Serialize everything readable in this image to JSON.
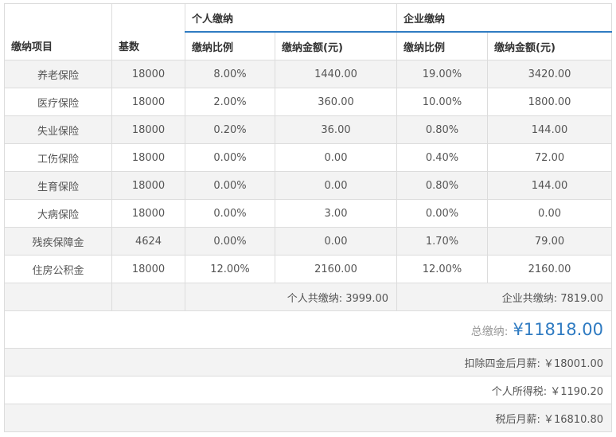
{
  "headers": {
    "item": "缴纳项目",
    "base": "基数",
    "personal_group": "个人缴纳",
    "company_group": "企业缴纳",
    "ratio": "缴纳比例",
    "amount": "缴纳金额(元)"
  },
  "rows": [
    {
      "name": "养老保险",
      "base": "18000",
      "p_ratio": "8.00%",
      "p_amount": "1440.00",
      "c_ratio": "19.00%",
      "c_amount": "3420.00"
    },
    {
      "name": "医疗保险",
      "base": "18000",
      "p_ratio": "2.00%",
      "p_amount": "360.00",
      "c_ratio": "10.00%",
      "c_amount": "1800.00"
    },
    {
      "name": "失业保险",
      "base": "18000",
      "p_ratio": "0.20%",
      "p_amount": "36.00",
      "c_ratio": "0.80%",
      "c_amount": "144.00"
    },
    {
      "name": "工伤保险",
      "base": "18000",
      "p_ratio": "0.00%",
      "p_amount": "0.00",
      "c_ratio": "0.40%",
      "c_amount": "72.00"
    },
    {
      "name": "生育保险",
      "base": "18000",
      "p_ratio": "0.00%",
      "p_amount": "0.00",
      "c_ratio": "0.80%",
      "c_amount": "144.00"
    },
    {
      "name": "大病保险",
      "base": "18000",
      "p_ratio": "0.00%",
      "p_amount": "3.00",
      "c_ratio": "0.00%",
      "c_amount": "0.00"
    },
    {
      "name": "残疾保障金",
      "base": "4624",
      "p_ratio": "0.00%",
      "p_amount": "0.00",
      "c_ratio": "1.70%",
      "c_amount": "79.00"
    },
    {
      "name": "住房公积金",
      "base": "18000",
      "p_ratio": "12.00%",
      "p_amount": "2160.00",
      "c_ratio": "12.00%",
      "c_amount": "2160.00"
    }
  ],
  "summary": {
    "personal_total": "个人共缴纳: 3999.00",
    "company_total": "企业共缴纳: 7819.00"
  },
  "total": {
    "label": "总缴纳:",
    "amount": "¥11818.00"
  },
  "after_deduction": "扣除四金后月薪: ￥18001.00",
  "income_tax": "个人所得税: ￥1190.20",
  "net_salary": "税后月薪: ￥16810.80"
}
